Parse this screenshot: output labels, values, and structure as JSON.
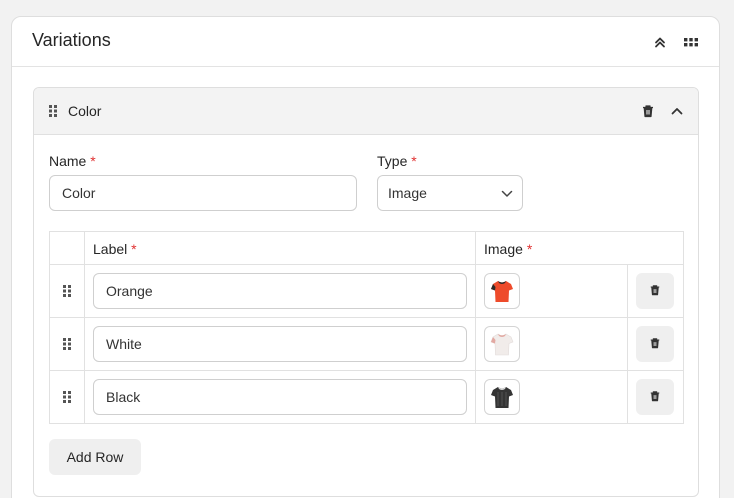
{
  "panel": {
    "title": "Variations",
    "icons": [
      "chevrons-up-icon",
      "grid-dots-icon"
    ]
  },
  "variation": {
    "title": "Color",
    "name_label": "Name",
    "name_value": "Color",
    "type_label": "Type",
    "type_value": "Image",
    "required_mark": "*"
  },
  "table": {
    "label_header": "Label",
    "image_header": "Image",
    "rows": [
      {
        "label": "Orange",
        "shirt_color": "#ee4b2b",
        "collar_color": "#2b2b2b"
      },
      {
        "label": "White",
        "shirt_color": "#f1ecea",
        "collar_color": "#e3a9a2"
      },
      {
        "label": "Black",
        "shirt_color": "#353535",
        "collar_color": "#d8d8d8"
      }
    ]
  },
  "add_row_label": "Add Row"
}
